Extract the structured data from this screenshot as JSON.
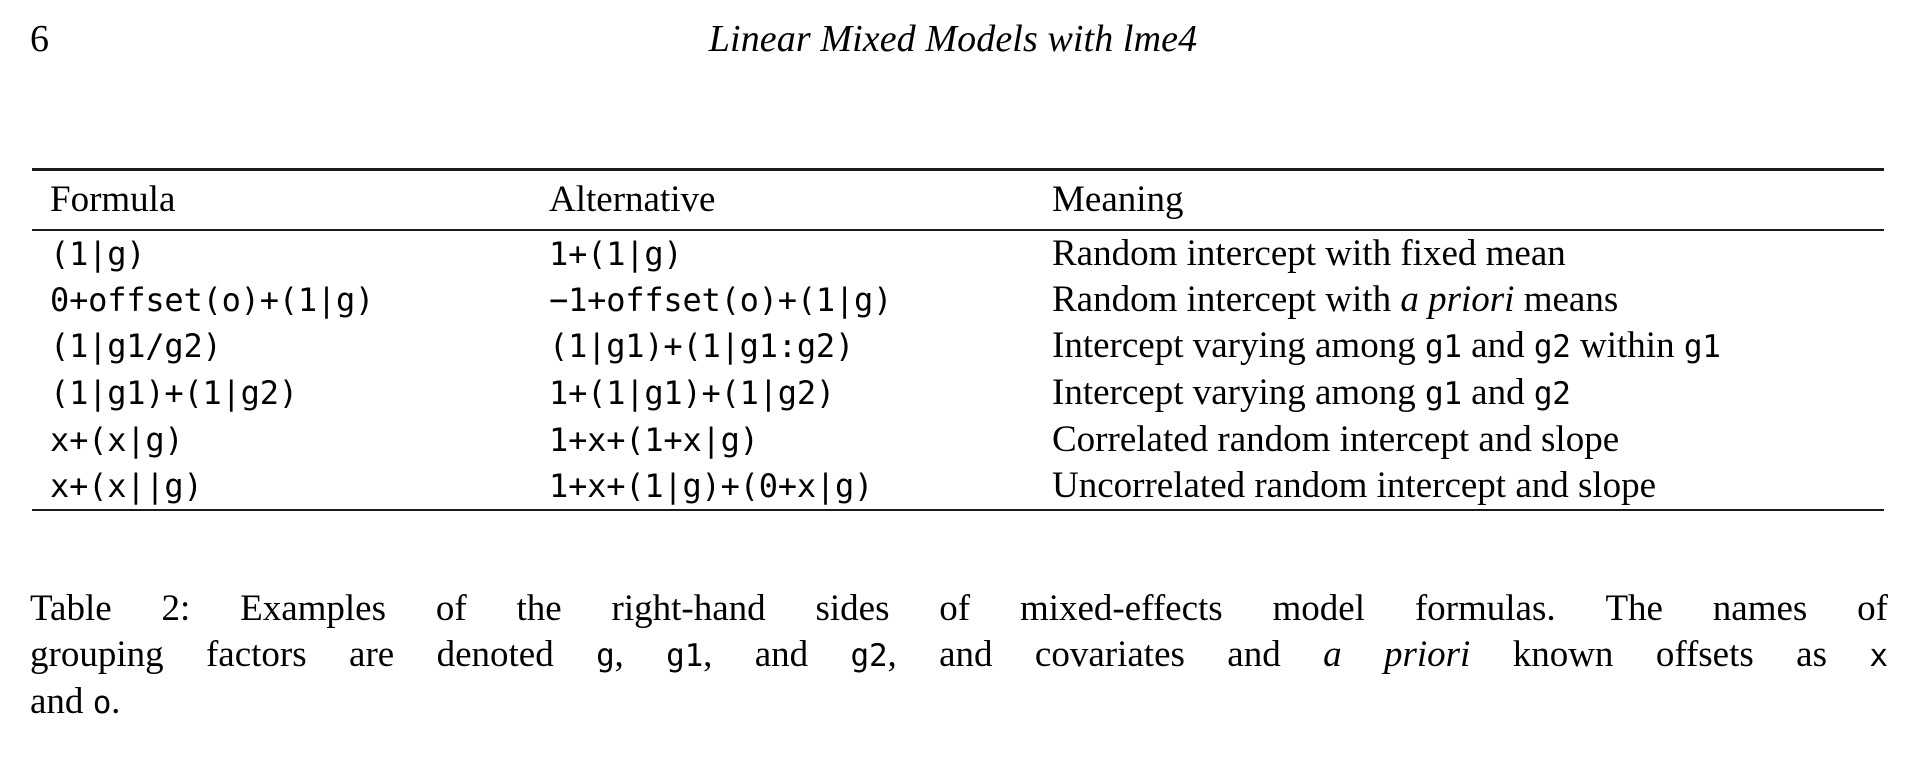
{
  "header": {
    "page_number": "6",
    "running_title": "Linear Mixed Models with lme4"
  },
  "table": {
    "columns": [
      "Formula",
      "Alternative",
      "Meaning"
    ],
    "rows": [
      {
        "formula": "(1|g)",
        "alternative": "1+(1|g)",
        "meaning_parts": [
          {
            "text": "Random intercept with fixed mean",
            "style": "roman"
          }
        ]
      },
      {
        "formula": "0+offset(o)+(1|g)",
        "alternative": "−1+offset(o)+(1|g)",
        "meaning_parts": [
          {
            "text": "Random intercept with ",
            "style": "roman"
          },
          {
            "text": "a priori",
            "style": "italic"
          },
          {
            "text": " means",
            "style": "roman"
          }
        ]
      },
      {
        "formula": "(1|g1/g2)",
        "alternative": "(1|g1)+(1|g1:g2)",
        "meaning_parts": [
          {
            "text": "Intercept varying among ",
            "style": "roman"
          },
          {
            "text": "g1",
            "style": "mono"
          },
          {
            "text": " and ",
            "style": "roman"
          },
          {
            "text": "g2",
            "style": "mono"
          },
          {
            "text": " within ",
            "style": "roman"
          },
          {
            "text": "g1",
            "style": "mono"
          }
        ]
      },
      {
        "formula": "(1|g1)+(1|g2)",
        "alternative": "1+(1|g1)+(1|g2)",
        "meaning_parts": [
          {
            "text": "Intercept varying among ",
            "style": "roman"
          },
          {
            "text": "g1",
            "style": "mono"
          },
          {
            "text": " and ",
            "style": "roman"
          },
          {
            "text": "g2",
            "style": "mono"
          }
        ]
      },
      {
        "formula": "x+(x|g)",
        "alternative": "1+x+(1+x|g)",
        "meaning_parts": [
          {
            "text": "Correlated random intercept and slope",
            "style": "roman"
          }
        ]
      },
      {
        "formula": "x+(x||g)",
        "alternative": "1+x+(1|g)+(0+x|g)",
        "meaning_parts": [
          {
            "text": "Uncorrelated random intercept and slope",
            "style": "roman"
          }
        ]
      }
    ]
  },
  "caption": {
    "label": "Table 2:",
    "full_text": "Table 2: Examples of the right-hand sides of mixed-effects model formulas. The names of grouping factors are denoted g, g1, and g2, and covariates and a priori known offsets as x and o.",
    "lines": [
      [
        {
          "text": "Table 2:",
          "style": "roman"
        },
        {
          "text": "  Examples of the right-hand sides of mixed-effects model formulas.  The names of",
          "style": "roman"
        }
      ],
      [
        {
          "text": "grouping factors are denoted ",
          "style": "roman"
        },
        {
          "text": "g",
          "style": "mono"
        },
        {
          "text": ", ",
          "style": "roman"
        },
        {
          "text": "g1",
          "style": "mono"
        },
        {
          "text": ", and ",
          "style": "roman"
        },
        {
          "text": "g2",
          "style": "mono"
        },
        {
          "text": ", and covariates and ",
          "style": "roman"
        },
        {
          "text": "a priori",
          "style": "italic"
        },
        {
          "text": " known offsets as ",
          "style": "roman"
        },
        {
          "text": "x",
          "style": "mono"
        }
      ],
      [
        {
          "text": "and ",
          "style": "roman"
        },
        {
          "text": "o",
          "style": "mono"
        },
        {
          "text": ".",
          "style": "roman"
        }
      ]
    ]
  },
  "colors": {
    "text": "#000000",
    "rule": "#1a1a1a",
    "background": "#ffffff"
  }
}
